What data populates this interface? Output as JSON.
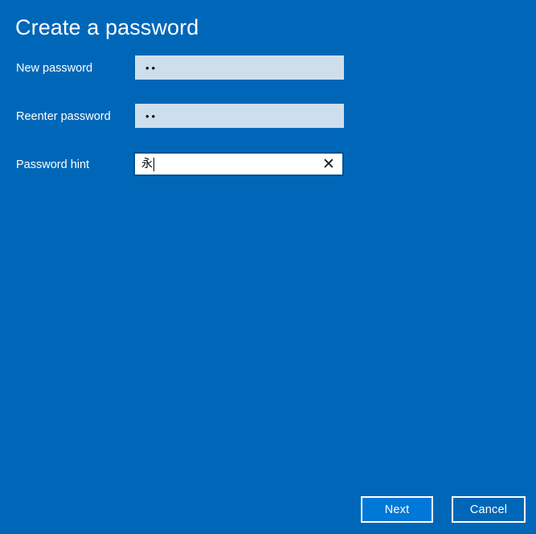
{
  "window": {
    "background_color": "#0067b8"
  },
  "header": {
    "title": "Create a password"
  },
  "form": {
    "fields": [
      {
        "label": "New password",
        "type": "password",
        "value": "••",
        "placeholder": "",
        "focused": false,
        "field_background": "#cddfed"
      },
      {
        "label": "Reenter password",
        "type": "password",
        "value": "••",
        "placeholder": "",
        "focused": false,
        "field_background": "#cddfed"
      },
      {
        "label": "Password hint",
        "type": "text",
        "value": "永",
        "placeholder": "",
        "focused": true,
        "field_background": "#ffffff",
        "clear_icon": "✕"
      }
    ]
  },
  "footer": {
    "buttons": [
      {
        "label": "Next",
        "style": "primary",
        "fill_color": "#0078d7",
        "border_color": "#ffffff"
      },
      {
        "label": "Cancel",
        "style": "secondary",
        "fill_color": "transparent",
        "border_color": "#ffffff"
      }
    ]
  }
}
